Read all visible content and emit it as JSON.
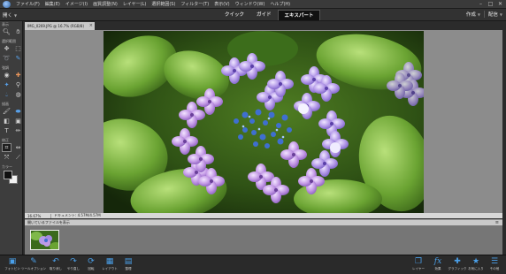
{
  "menu": {
    "items": [
      "ファイル(F)",
      "編集(E)",
      "イメージ(I)",
      "画質調整(N)",
      "レイヤー(L)",
      "選択範囲(S)",
      "フィルター(T)",
      "表示(V)",
      "ウィンドウ(W)",
      "ヘルプ(H)"
    ]
  },
  "modebar": {
    "open_label": "開く",
    "tabs": [
      "クイック",
      "ガイド",
      "エキスパート"
    ],
    "active_tab": "エキスパート",
    "create_label": "作成",
    "share_label": "配信"
  },
  "toolbox": {
    "groups": [
      "表示",
      "選択範囲",
      "強調",
      "描画",
      "修正",
      "カラー"
    ]
  },
  "document": {
    "tab_label": "IMG_0269.JPG @ 16.7% (RGB/8)",
    "zoom": "16.67%",
    "info": "ドキュメント: 4.57M/4.57M"
  },
  "photo_bin": {
    "dropdown_label": "開いているファイルを表示"
  },
  "taskbar": {
    "left": [
      {
        "label": "フォトビン",
        "icon": "photo-bin-icon"
      },
      {
        "label": "ツールオプション",
        "icon": "tool-options-icon"
      },
      {
        "label": "取り消し",
        "icon": "undo-icon"
      },
      {
        "label": "やり直し",
        "icon": "redo-icon"
      },
      {
        "label": "回転",
        "icon": "rotate-icon"
      },
      {
        "label": "レイアウト",
        "icon": "layout-icon"
      },
      {
        "label": "整理",
        "icon": "organizer-icon"
      }
    ],
    "right": [
      {
        "label": "レイヤー",
        "icon": "layers-icon"
      },
      {
        "label": "効果",
        "icon": "effects-icon"
      },
      {
        "label": "グラフィック",
        "icon": "graphics-icon"
      },
      {
        "label": "お気に入り",
        "icon": "favorites-icon"
      },
      {
        "label": "その他",
        "icon": "more-icon"
      }
    ]
  },
  "colors": {
    "accent_blue": "#3b8ee0",
    "background": "#2b2b2b",
    "canvas_gray": "#8c8c8c"
  }
}
